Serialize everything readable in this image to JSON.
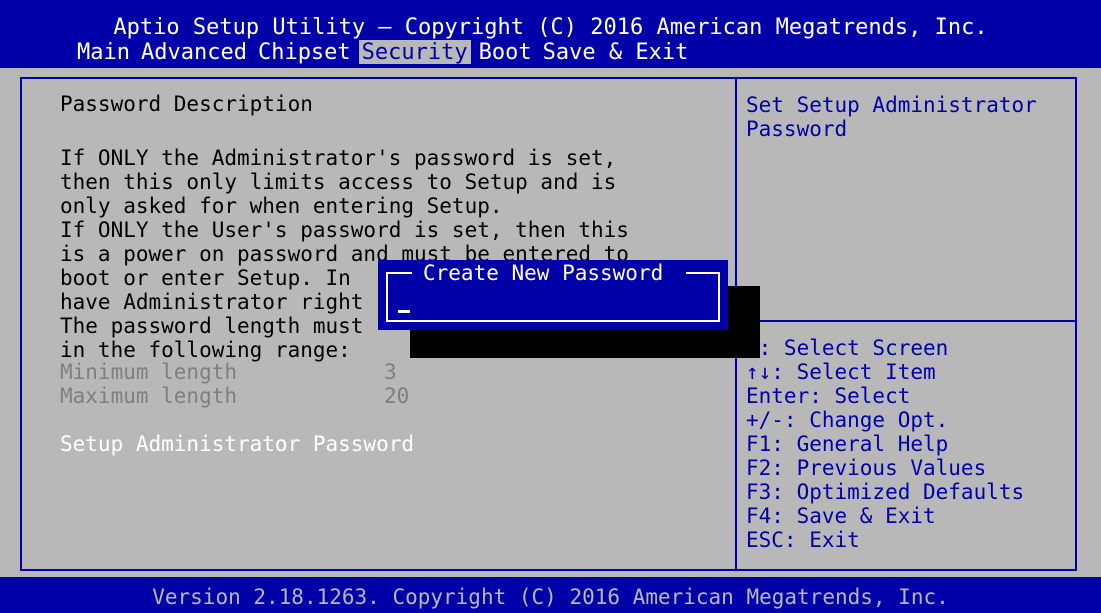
{
  "header": {
    "title": "Aptio Setup Utility – Copyright (C) 2016 American Megatrends, Inc."
  },
  "menu": {
    "items": [
      {
        "label": "Main",
        "active": false
      },
      {
        "label": "Advanced",
        "active": false
      },
      {
        "label": "Chipset",
        "active": false
      },
      {
        "label": "Security",
        "active": true
      },
      {
        "label": "Boot",
        "active": false
      },
      {
        "label": "Save & Exit",
        "active": false
      }
    ]
  },
  "main": {
    "description_title": "Password Description",
    "description_lines": [
      "If ONLY the Administrator's password is set,",
      "then this only limits access to Setup and is",
      "only asked for when entering Setup.",
      "If ONLY the User's password is set, then this",
      "is a power on password and must be entered to",
      "boot or enter Setup. In",
      "have Administrator right",
      "The password length must",
      "in the following range:"
    ],
    "min_label": "Minimum length",
    "min_value": "3",
    "max_label": "Maximum length",
    "max_value": "20",
    "selected_item": "Setup Administrator Password"
  },
  "help": {
    "description_lines": [
      "Set Setup Administrator",
      "Password"
    ],
    "keys": [
      "<: Select Screen",
      "↑↓: Select Item",
      "Enter: Select",
      "+/-: Change Opt.",
      "F1: General Help",
      "F2: Previous Values",
      "F3: Optimized Defaults",
      "F4: Save & Exit",
      "ESC: Exit"
    ]
  },
  "popup": {
    "title": "Create New Password",
    "value": ""
  },
  "footer": {
    "text": "Version 2.18.1263. Copyright (C) 2016 American Megatrends, Inc."
  },
  "colors": {
    "bios_blue": "#0000a8",
    "bios_gray": "#b8b8b8",
    "text_white": "#ffffff",
    "text_dim": "#7f7f7f"
  }
}
